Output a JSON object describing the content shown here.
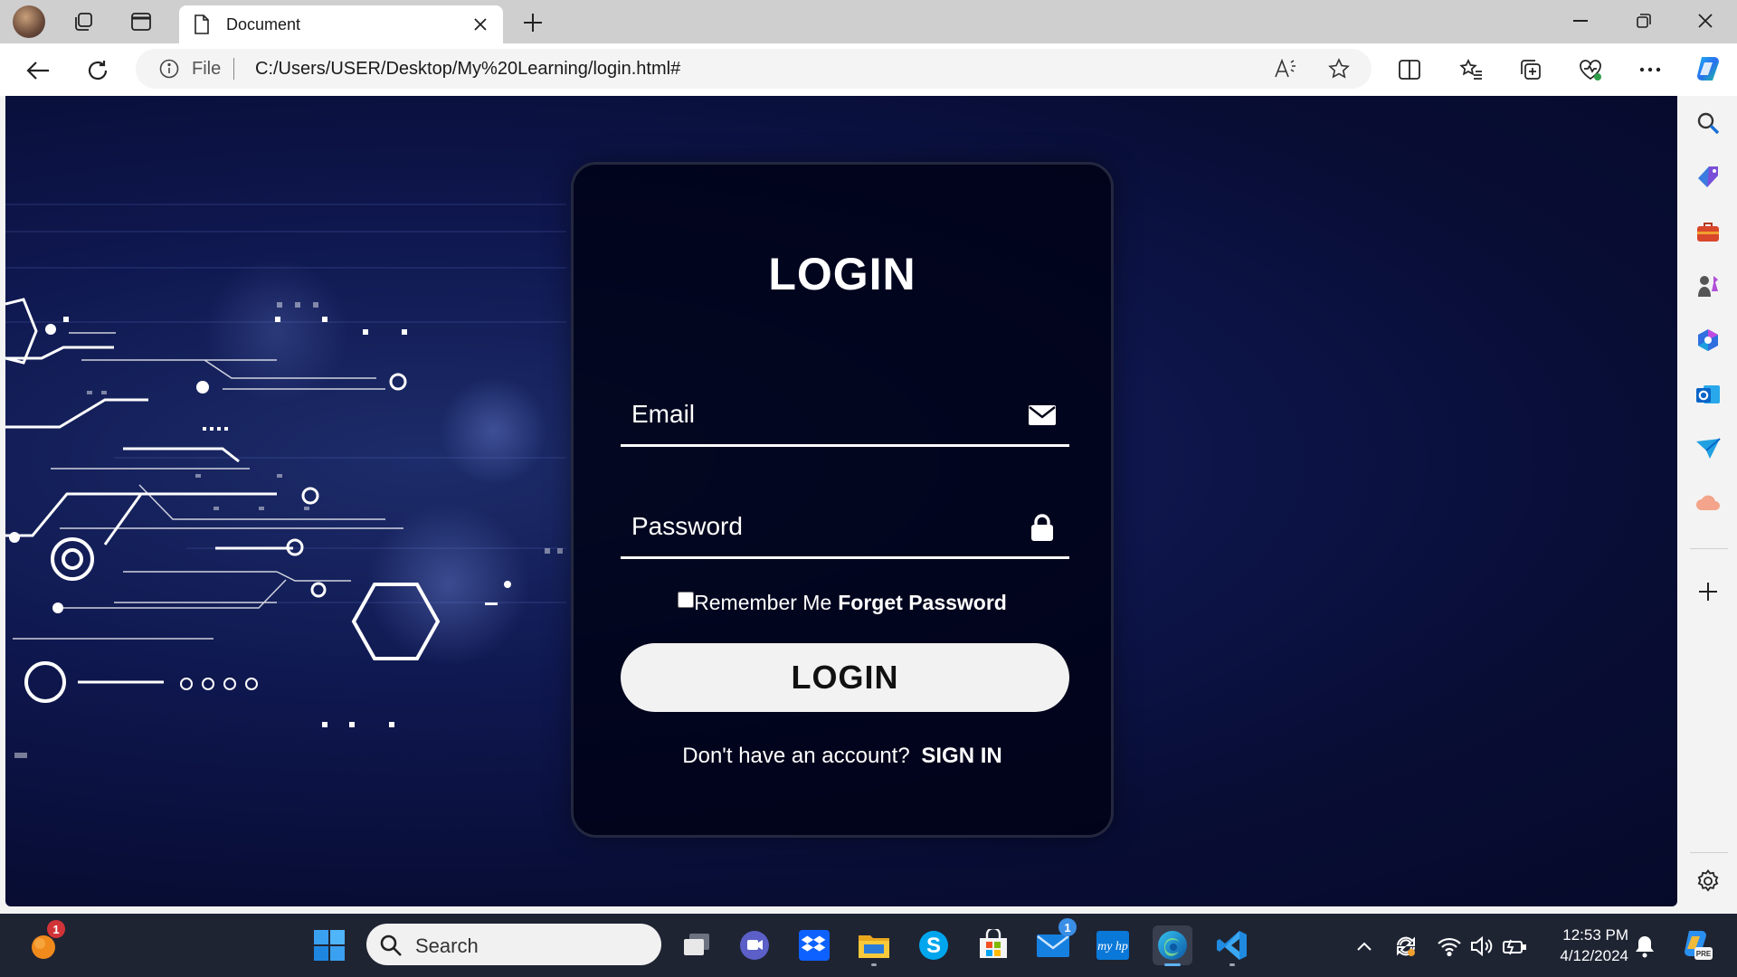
{
  "browser": {
    "tab_title": "Document",
    "url_scheme_label": "File",
    "url": "C:/Users/USER/Desktop/My%20Learning/login.html#"
  },
  "login": {
    "title": "LOGIN",
    "email_placeholder": "Email",
    "password_placeholder": "Password",
    "remember_label": "Remember Me",
    "forget_label": "Forget Password",
    "button_label": "LOGIN",
    "signup_prompt": "Don't have an account?",
    "signup_link": "SIGN IN"
  },
  "taskbar": {
    "search_placeholder": "Search",
    "notification_badge": "1",
    "mail_badge": "1",
    "time": "12:53 PM",
    "date": "4/12/2024"
  },
  "colors": {
    "page_background": "#0a1040",
    "card_background": "#000216",
    "button_background": "#f2f2f2",
    "accent": "#0078d4"
  },
  "icons": {
    "titlebar": [
      "profile-avatar",
      "workspaces-icon",
      "vertical-tabs-icon",
      "document-icon",
      "close-icon",
      "plus-icon",
      "minimize-icon",
      "restore-icon",
      "window-close-icon"
    ],
    "navbar": [
      "back-arrow-icon",
      "refresh-icon",
      "info-icon",
      "read-aloud-icon",
      "favorite-star-icon",
      "split-screen-icon",
      "favorites-icon",
      "collections-icon",
      "browser-essentials-icon",
      "more-icon",
      "copilot-icon"
    ],
    "sidebar": [
      "search-icon",
      "shopping-tag-icon",
      "tools-briefcase-icon",
      "games-icon",
      "microsoft365-icon",
      "outlook-icon",
      "drop-send-icon",
      "cloud-icon",
      "add-icon",
      "settings-gear-icon"
    ],
    "form": [
      "envelope-icon",
      "lock-icon"
    ]
  }
}
